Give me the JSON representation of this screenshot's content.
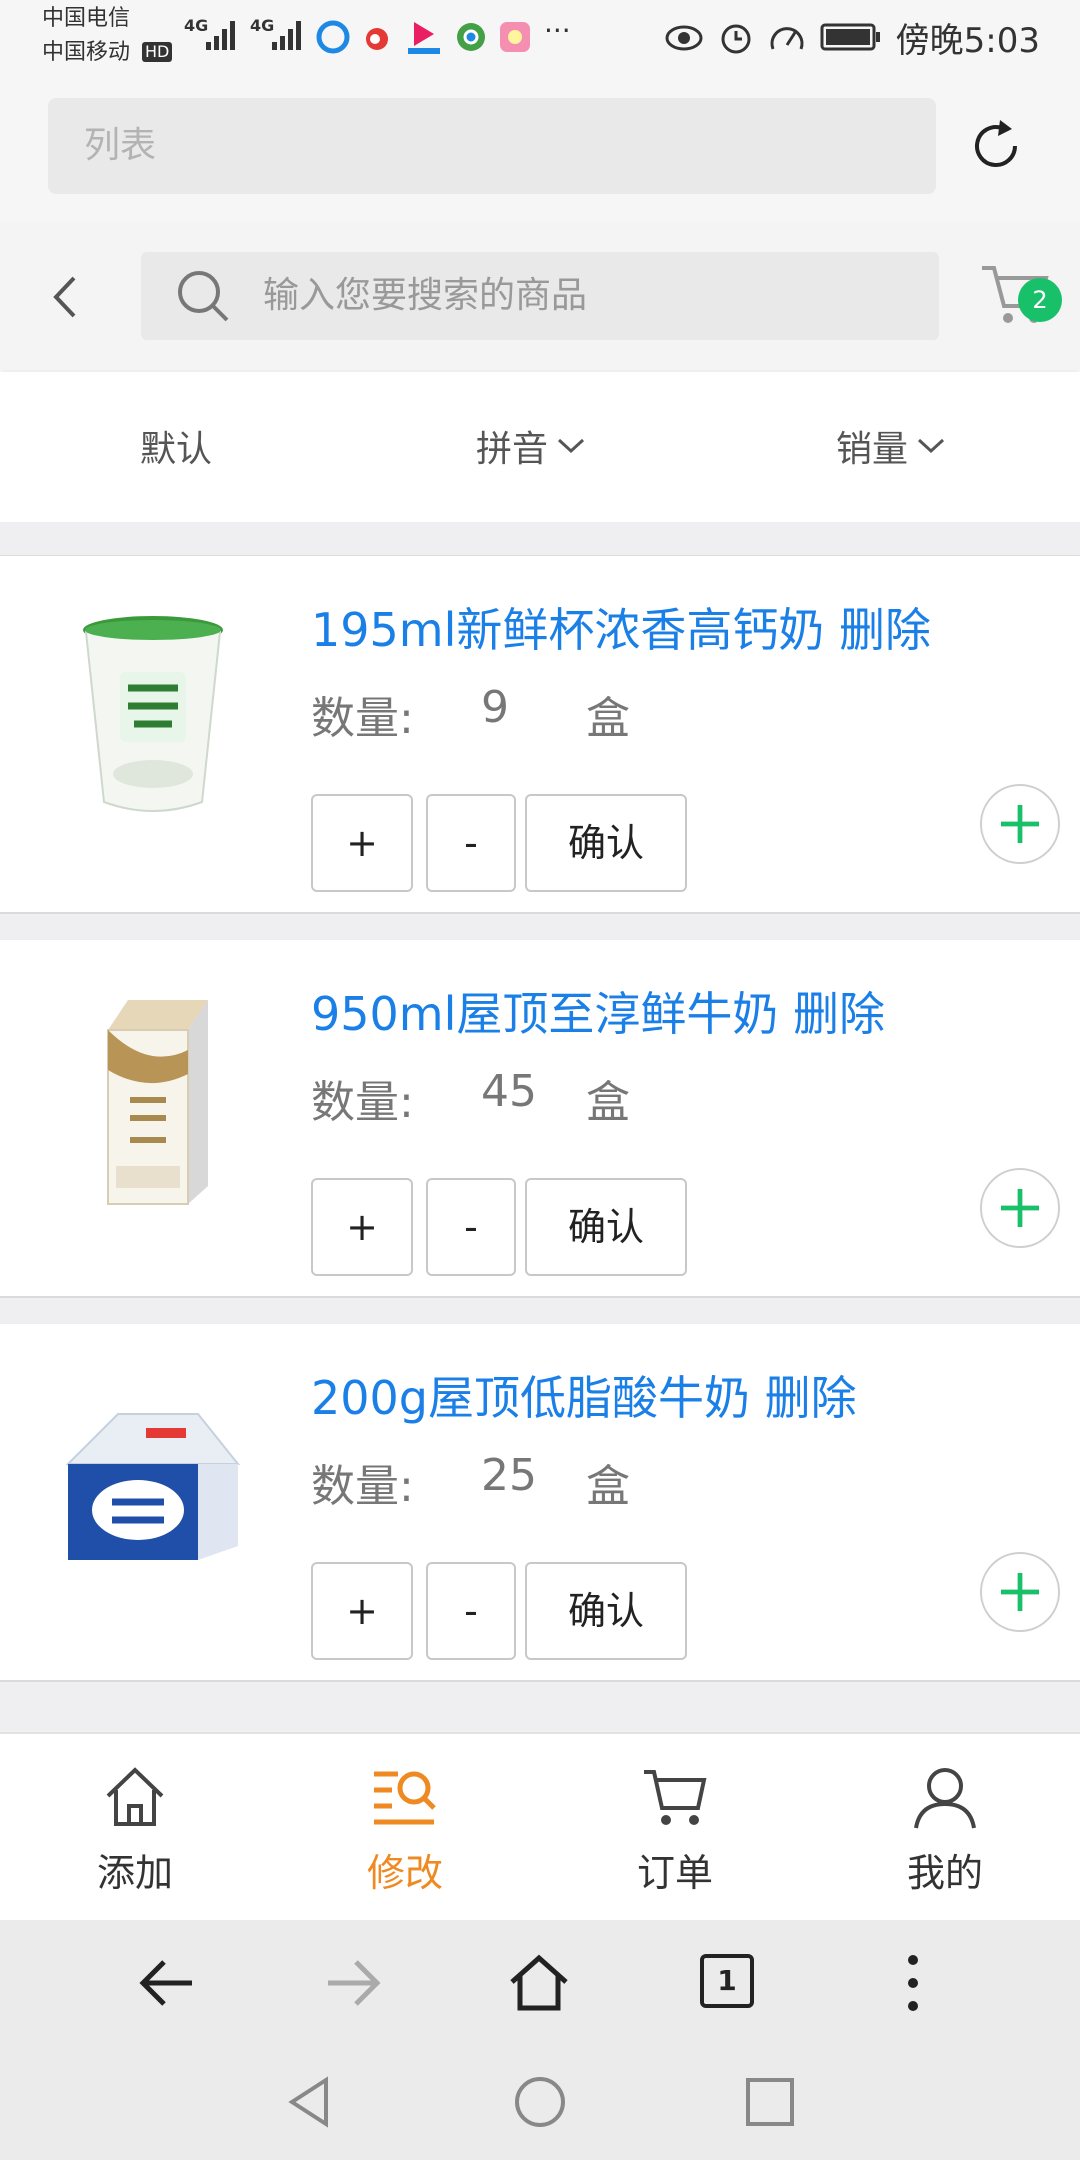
{
  "status_bar": {
    "carrier_top": "中国电信",
    "carrier_bottom": "中国移动",
    "hd_badge": "HD",
    "network_1": "4G",
    "network_2": "4G",
    "more": "···",
    "time": "傍晚5:03",
    "icons": [
      "eye-comfort-icon",
      "alarm-icon",
      "speed-icon",
      "battery-icon"
    ]
  },
  "browser": {
    "url_text": "列表",
    "tab_count": "1"
  },
  "search": {
    "placeholder": "输入您要搜索的商品",
    "cart_count": "2"
  },
  "sort": {
    "default": "默认",
    "pinyin": "拼音",
    "sales": "销量"
  },
  "products": [
    {
      "name": "195ml新鲜杯浓香高钙奶",
      "delete": "删除",
      "qty_label": "数量:",
      "qty": "9",
      "unit": "盒",
      "plus": "+",
      "minus": "-",
      "confirm": "确认"
    },
    {
      "name": "950ml屋顶至淳鲜牛奶",
      "delete": "删除",
      "qty_label": "数量:",
      "qty": "45",
      "unit": "盒",
      "plus": "+",
      "minus": "-",
      "confirm": "确认"
    },
    {
      "name": "200g屋顶低脂酸牛奶",
      "delete": "删除",
      "qty_label": "数量:",
      "qty": "25",
      "unit": "盒",
      "plus": "+",
      "minus": "-",
      "confirm": "确认"
    }
  ],
  "tabbar": {
    "items": [
      {
        "label": "添加",
        "icon": "home-icon"
      },
      {
        "label": "修改",
        "icon": "edit-list-icon",
        "active": true
      },
      {
        "label": "订单",
        "icon": "cart-icon"
      },
      {
        "label": "我的",
        "icon": "user-icon"
      }
    ]
  },
  "colors": {
    "accent_blue": "#1a7fe6",
    "active_orange": "#ef8a22",
    "badge_green": "#19c06a"
  }
}
